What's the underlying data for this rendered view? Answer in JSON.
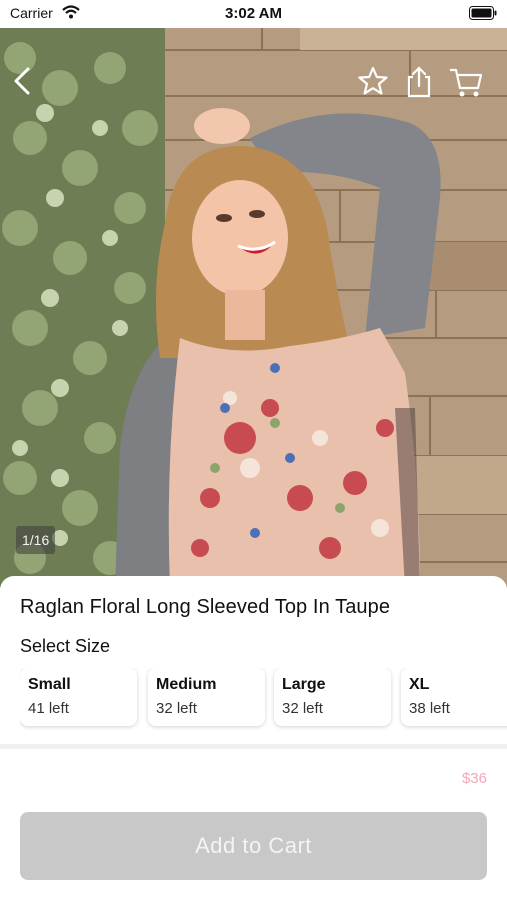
{
  "status_bar": {
    "carrier": "Carrier",
    "time": "3:02 AM"
  },
  "hero": {
    "image_counter": "1/16"
  },
  "nav": {
    "icons": [
      "back-icon",
      "star-icon",
      "share-icon",
      "cart-icon"
    ]
  },
  "product": {
    "title": "Raglan Floral Long Sleeved Top In Taupe",
    "size_heading": "Select Size",
    "sizes": [
      {
        "name": "Small",
        "stock": "41 left"
      },
      {
        "name": "Medium",
        "stock": "32 left"
      },
      {
        "name": "Large",
        "stock": "32 left"
      },
      {
        "name": "XL",
        "stock": "38 left"
      }
    ],
    "price": "$36",
    "add_to_cart_label": "Add to Cart"
  },
  "colors": {
    "price": "#f7a6b8",
    "button_disabled": "#c8c8c8"
  }
}
